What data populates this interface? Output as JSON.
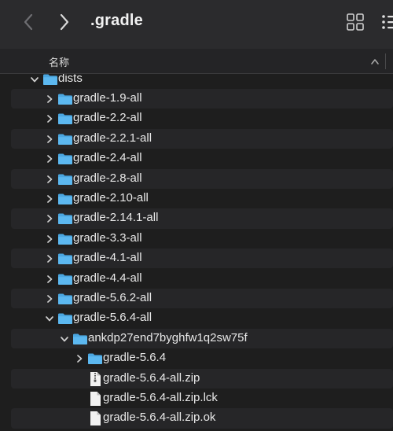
{
  "window": {
    "title": ".gradle",
    "back_icon": "chevron-left-icon",
    "forward_icon": "chevron-right-icon",
    "view_icons": [
      "grid-view-icon",
      "list-view-icon"
    ]
  },
  "header": {
    "name_column": "名称",
    "sort_icon": "chevron-up-icon"
  },
  "rows": [
    {
      "label": "dists",
      "depth": 0,
      "kind": "folder",
      "expanded": true
    },
    {
      "label": "gradle-1.9-all",
      "depth": 1,
      "kind": "folder",
      "expanded": false
    },
    {
      "label": "gradle-2.2-all",
      "depth": 1,
      "kind": "folder",
      "expanded": false
    },
    {
      "label": "gradle-2.2.1-all",
      "depth": 1,
      "kind": "folder",
      "expanded": false
    },
    {
      "label": "gradle-2.4-all",
      "depth": 1,
      "kind": "folder",
      "expanded": false
    },
    {
      "label": "gradle-2.8-all",
      "depth": 1,
      "kind": "folder",
      "expanded": false
    },
    {
      "label": "gradle-2.10-all",
      "depth": 1,
      "kind": "folder",
      "expanded": false
    },
    {
      "label": "gradle-2.14.1-all",
      "depth": 1,
      "kind": "folder",
      "expanded": false
    },
    {
      "label": "gradle-3.3-all",
      "depth": 1,
      "kind": "folder",
      "expanded": false
    },
    {
      "label": "gradle-4.1-all",
      "depth": 1,
      "kind": "folder",
      "expanded": false
    },
    {
      "label": "gradle-4.4-all",
      "depth": 1,
      "kind": "folder",
      "expanded": false
    },
    {
      "label": "gradle-5.6.2-all",
      "depth": 1,
      "kind": "folder",
      "expanded": false
    },
    {
      "label": "gradle-5.6.4-all",
      "depth": 1,
      "kind": "folder",
      "expanded": true
    },
    {
      "label": "ankdp27end7byghfw1q2sw75f",
      "depth": 2,
      "kind": "folder",
      "expanded": true
    },
    {
      "label": "gradle-5.6.4",
      "depth": 3,
      "kind": "folder",
      "expanded": false
    },
    {
      "label": "gradle-5.6.4-all.zip",
      "depth": 3,
      "kind": "zip"
    },
    {
      "label": "gradle-5.6.4-all.zip.lck",
      "depth": 3,
      "kind": "file"
    },
    {
      "label": "gradle-5.6.4-all.zip.ok",
      "depth": 3,
      "kind": "file"
    }
  ],
  "colors": {
    "folder": "#5cb8f0",
    "folder_tab": "#4aa6e0",
    "file": "#f2f2f2"
  }
}
